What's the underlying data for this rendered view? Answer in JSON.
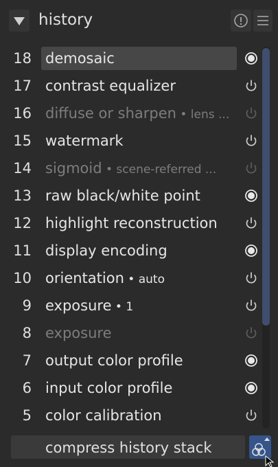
{
  "header": {
    "title": "history"
  },
  "history_items": [
    {
      "num": "18",
      "name": "demosaic",
      "detail": "",
      "state": "on",
      "selected": true,
      "disabled": false
    },
    {
      "num": "17",
      "name": "contrast equalizer",
      "detail": "",
      "state": "off",
      "selected": false,
      "disabled": false
    },
    {
      "num": "16",
      "name": "diffuse or sharpen",
      "detail": " • lens ...",
      "state": "off",
      "selected": false,
      "disabled": true
    },
    {
      "num": "15",
      "name": "watermark",
      "detail": "",
      "state": "off",
      "selected": false,
      "disabled": false
    },
    {
      "num": "14",
      "name": "sigmoid",
      "detail": " • scene-referred ...",
      "state": "off",
      "selected": false,
      "disabled": true
    },
    {
      "num": "13",
      "name": "raw black/white point",
      "detail": "",
      "state": "on",
      "selected": false,
      "disabled": false
    },
    {
      "num": "12",
      "name": "highlight reconstruction",
      "detail": "",
      "state": "off",
      "selected": false,
      "disabled": false
    },
    {
      "num": "11",
      "name": "display encoding",
      "detail": "",
      "state": "on",
      "selected": false,
      "disabled": false
    },
    {
      "num": "10",
      "name": "orientation",
      "detail": " • auto",
      "state": "off",
      "selected": false,
      "disabled": false
    },
    {
      "num": "9",
      "name": "exposure",
      "detail": " • 1",
      "state": "off",
      "selected": false,
      "disabled": false
    },
    {
      "num": "8",
      "name": "exposure",
      "detail": "",
      "state": "off",
      "selected": false,
      "disabled": true
    },
    {
      "num": "7",
      "name": "output color profile",
      "detail": "",
      "state": "on",
      "selected": false,
      "disabled": false
    },
    {
      "num": "6",
      "name": "input color profile",
      "detail": "",
      "state": "on",
      "selected": false,
      "disabled": false
    },
    {
      "num": "5",
      "name": "color calibration",
      "detail": "",
      "state": "off",
      "selected": false,
      "disabled": false
    }
  ],
  "footer": {
    "compress_label": "compress history stack"
  },
  "icons": {
    "collapse": "triangle-down-icon",
    "info": "info-icon",
    "menu": "hamburger-menu-icon",
    "on": "radio-on-icon",
    "off": "power-icon",
    "style": "create-style-icon"
  },
  "colors": {
    "background": "#2b2b2b",
    "selected_row": "#474747",
    "accent": "#35548a",
    "scroll_thumb": "#3f4e6e",
    "disabled_text": "#7d7d7d"
  }
}
